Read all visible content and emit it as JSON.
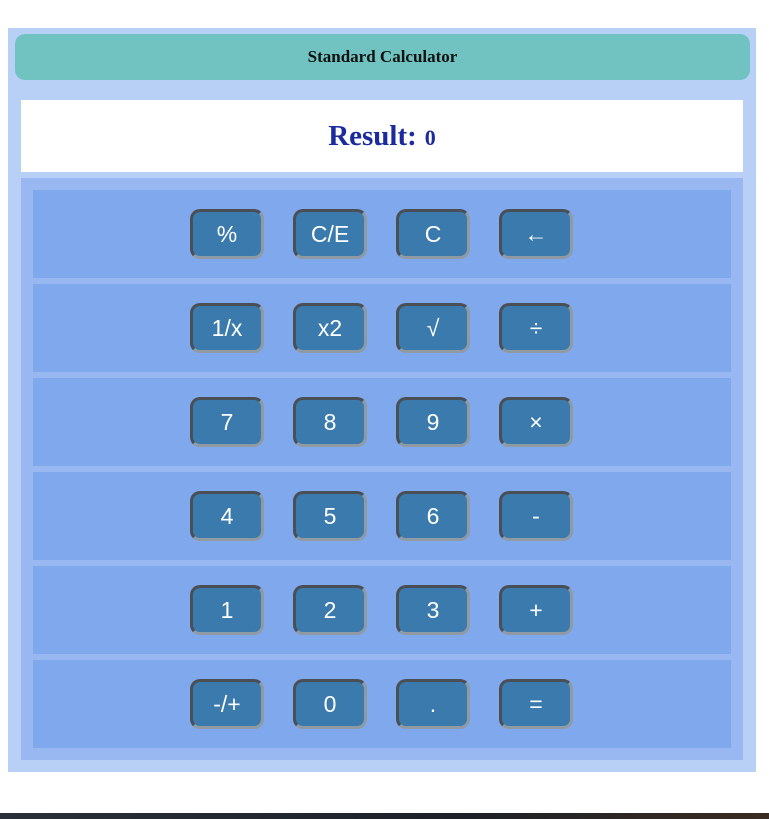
{
  "calculator": {
    "title": "Standard Calculator",
    "result_label": "Result:",
    "result_value": "0"
  },
  "keypad": {
    "rows": [
      [
        "%",
        "C/E",
        "C",
        "←"
      ],
      [
        "1/x",
        "x2",
        "√",
        "÷"
      ],
      [
        "7",
        "8",
        "9",
        "×"
      ],
      [
        "4",
        "5",
        "6",
        "-"
      ],
      [
        "1",
        "2",
        "3",
        "+"
      ],
      [
        "-/+",
        "0",
        ".",
        "="
      ]
    ]
  },
  "colors": {
    "page_background": "#b8d0f6",
    "title_bar": "#71c3c1",
    "result_text": "#1b2a9c",
    "keypad_row": "#80a8ec",
    "button": "#3a7aad"
  }
}
